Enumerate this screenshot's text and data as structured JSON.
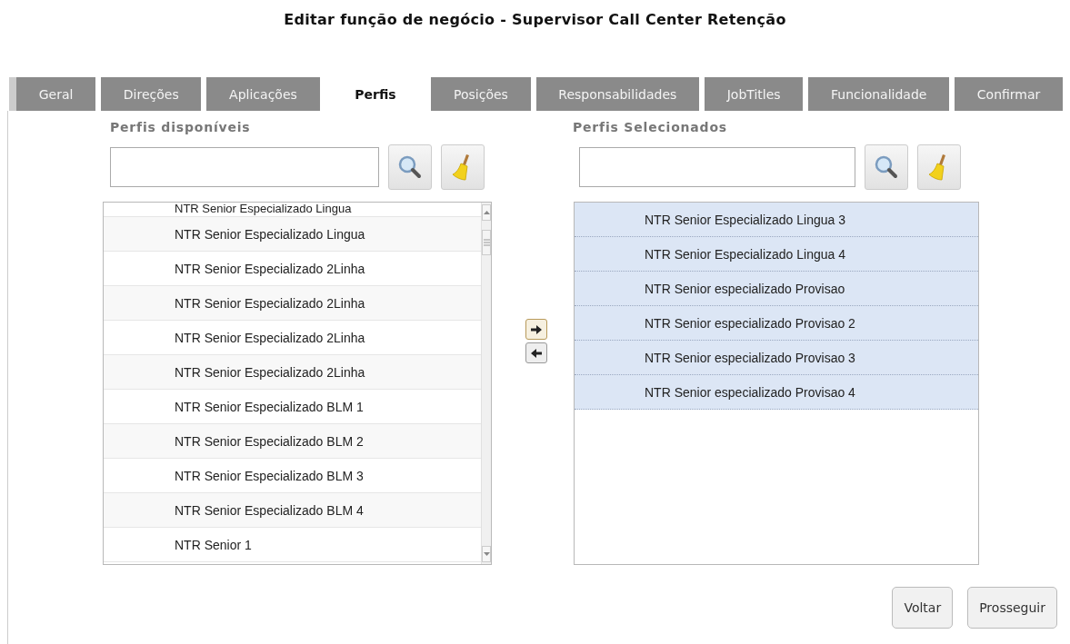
{
  "page": {
    "title": "Editar função de negócio - Supervisor Call Center Retenção"
  },
  "tabs": [
    {
      "label": "Geral",
      "selected": false
    },
    {
      "label": "Direções",
      "selected": false
    },
    {
      "label": "Aplicações",
      "selected": false
    },
    {
      "label": "Perfis",
      "selected": true
    },
    {
      "label": "Posições",
      "selected": false
    },
    {
      "label": "Responsabilidades",
      "selected": false
    },
    {
      "label": "JobTitles",
      "selected": false
    },
    {
      "label": "Funcionalidade",
      "selected": false
    },
    {
      "label": "Confirmar",
      "selected": false
    }
  ],
  "available": {
    "heading": "Perfis disponíveis",
    "items": [
      {
        "label": "NTR Senior Especializado Lingua",
        "selected": false
      },
      {
        "label": "NTR Senior Especializado Lingua",
        "selected": false
      },
      {
        "label": "NTR Senior Especializado 2Linha",
        "selected": false
      },
      {
        "label": "NTR Senior Especializado 2Linha",
        "selected": false
      },
      {
        "label": "NTR Senior Especializado 2Linha",
        "selected": false
      },
      {
        "label": "NTR Senior Especializado 2Linha",
        "selected": false
      },
      {
        "label": "NTR Senior Especializado BLM 1",
        "selected": false
      },
      {
        "label": "NTR Senior Especializado BLM 2",
        "selected": false
      },
      {
        "label": "NTR Senior Especializado BLM 3",
        "selected": false
      },
      {
        "label": "NTR Senior Especializado BLM 4",
        "selected": false
      },
      {
        "label": "NTR Senior 1",
        "selected": false
      }
    ]
  },
  "chosen": {
    "heading": "Perfis Selecionados",
    "items": [
      {
        "label": "NTR Senior Especializado Lingua 3",
        "selected": true
      },
      {
        "label": "NTR Senior Especializado Lingua 4",
        "selected": true
      },
      {
        "label": "NTR Senior especializado Provisao",
        "selected": true
      },
      {
        "label": "NTR Senior especializado Provisao 2",
        "selected": true
      },
      {
        "label": "NTR Senior especializado Provisao 3",
        "selected": true
      },
      {
        "label": "NTR Senior especializado Provisao 4",
        "selected": true
      }
    ]
  },
  "buttons": [
    "Voltar",
    "Prosseguir"
  ]
}
